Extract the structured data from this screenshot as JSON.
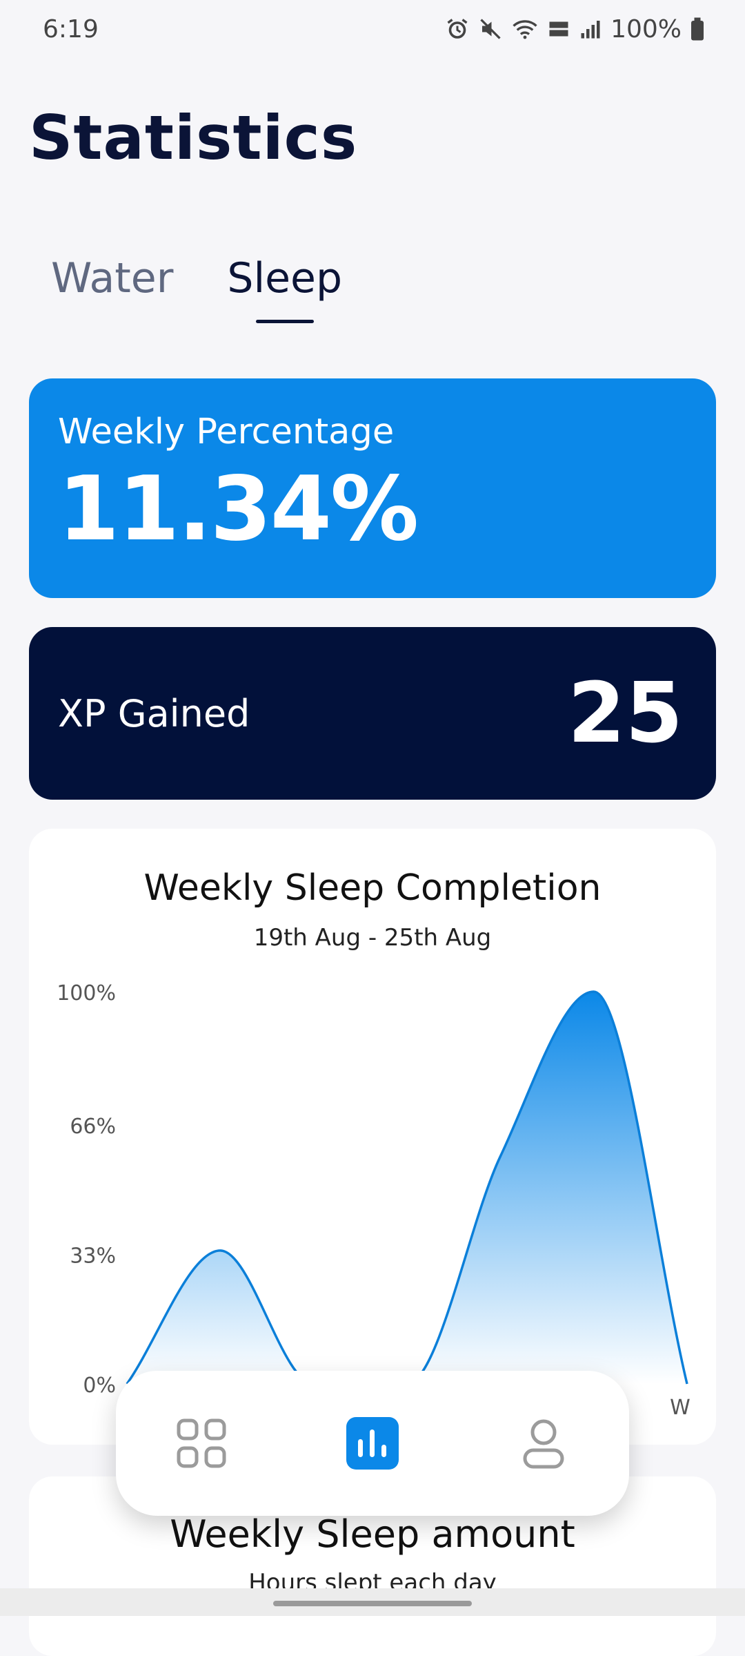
{
  "status_bar": {
    "time": "6:19",
    "battery": "100%"
  },
  "page": {
    "title": "Statistics"
  },
  "tabs": [
    {
      "label": "Water"
    },
    {
      "label": "Sleep"
    }
  ],
  "weekly_percentage": {
    "label": "Weekly Percentage",
    "value": "11.34%"
  },
  "xp": {
    "label": "XP Gained",
    "value": "25"
  },
  "chart": {
    "title": "Weekly Sleep Completion",
    "subtitle": "19th Aug - 25th Aug"
  },
  "amount_card": {
    "title": "Weekly Sleep amount",
    "subtitle": "Hours slept each day"
  },
  "bottom_nav": {
    "items": [
      {
        "icon": "grid-icon"
      },
      {
        "icon": "bar-chart-icon",
        "active": true
      },
      {
        "icon": "person-icon"
      }
    ]
  },
  "colors": {
    "accent": "#0b88e8",
    "dark": "#02113a",
    "background": "#f6f6f9",
    "title": "#0b1437"
  },
  "chart_data": {
    "type": "area",
    "title": "Weekly Sleep Completion",
    "subtitle": "19th Aug - 25th Aug",
    "y_ticks": [
      "0%",
      "33%",
      "66%",
      "100%"
    ],
    "ylim": [
      0,
      100
    ],
    "x": [
      0,
      1,
      2,
      3,
      4,
      5,
      6
    ],
    "x_tick_labels": [
      "",
      "",
      "",
      "",
      "",
      "",
      "W"
    ],
    "values": [
      0,
      34,
      0,
      0,
      58,
      100,
      0
    ]
  }
}
